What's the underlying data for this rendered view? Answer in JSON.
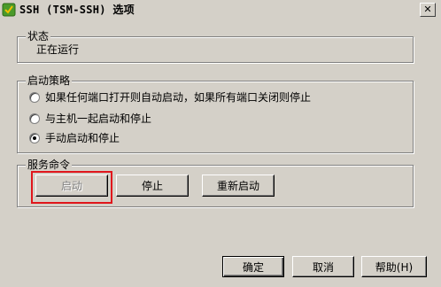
{
  "window": {
    "title": "SSH (TSM-SSH) 选项",
    "close_label": "✕"
  },
  "status_group": {
    "legend": "状态",
    "value": "正在运行"
  },
  "policy_group": {
    "legend": "启动策略",
    "options": [
      {
        "label": "如果任何端口打开则自动启动，如果所有端口关闭则停止",
        "selected": false
      },
      {
        "label": "与主机一起启动和停止",
        "selected": false
      },
      {
        "label": "手动启动和停止",
        "selected": true
      }
    ]
  },
  "service_group": {
    "legend": "服务命令",
    "start_label": "启动",
    "stop_label": "停止",
    "restart_label": "重新启动"
  },
  "footer": {
    "ok_label": "确定",
    "cancel_label": "取消",
    "help_label": "帮助(H)"
  },
  "colors": {
    "face": "#d4d0c8",
    "highlight": "#e0161c",
    "icon_green": "#4a9a2a",
    "icon_yellow": "#f0c000"
  }
}
